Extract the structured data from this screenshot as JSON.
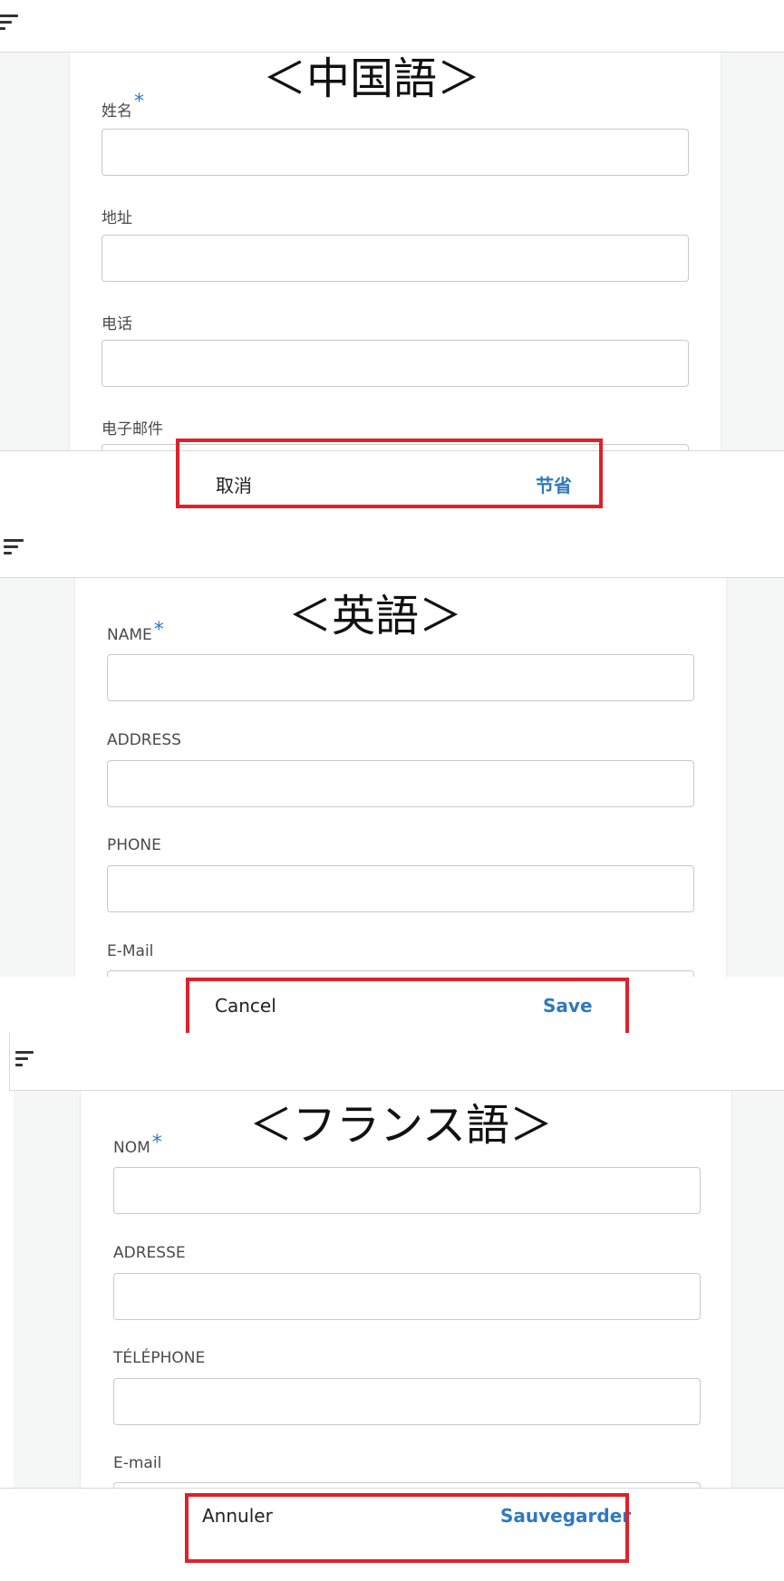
{
  "chinese": {
    "heading": "＜中国語＞",
    "name_label": "姓名",
    "required_mark": "*",
    "address_label": "地址",
    "phone_label": "电话",
    "email_label": "电子邮件",
    "cancel": "取消",
    "save": "节省"
  },
  "english": {
    "heading": "＜英語＞",
    "name_label": "NAME",
    "required_mark": "*",
    "address_label": "ADDRESS",
    "phone_label": "PHONE",
    "email_label": "E-Mail",
    "cancel": "Cancel",
    "save": "Save"
  },
  "french": {
    "heading": "＜フランス語＞",
    "name_label": "NOM",
    "required_mark": "*",
    "address_label": "ADRESSE",
    "phone_label": "TÉLÉPHONE",
    "email_label": "E-mail",
    "cancel": "Annuler",
    "save": "Sauvegarder"
  },
  "colors": {
    "accent": "#2f79c1",
    "highlight_box": "#e0202a",
    "background": "#f5f6f6"
  },
  "icons": {
    "menu": "filter-menu-icon"
  }
}
